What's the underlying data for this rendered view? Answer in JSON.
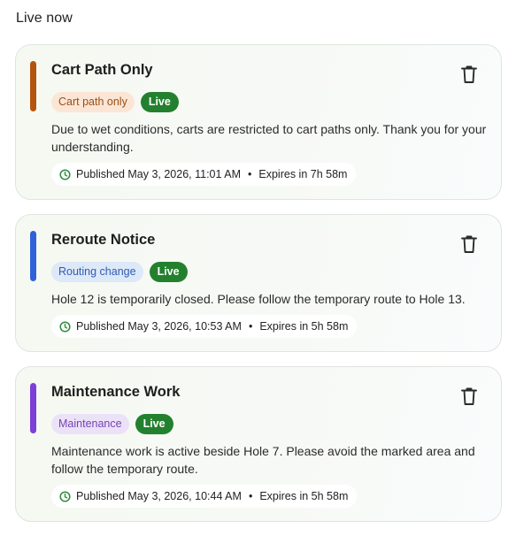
{
  "section": {
    "title": "Live now"
  },
  "colors": {
    "live_badge_bg": "#23802e",
    "clock_icon": "#2e8b3d"
  },
  "notices": [
    {
      "title": "Cart Path Only",
      "accent_color": "#b5540f",
      "category": {
        "label": "Cart path only",
        "bg": "#fbe6d6",
        "fg": "#9b4e15"
      },
      "status": "Live",
      "message": "Due to wet conditions, carts are restricted to cart paths only. Thank you for your understanding.",
      "published": "Published May 3, 2026, 11:01 AM",
      "separator": "•",
      "expires": "Expires in 7h 58m",
      "icons": {
        "delete": "trash-icon",
        "time": "clock-icon"
      }
    },
    {
      "title": "Reroute Notice",
      "accent_color": "#2f62d8",
      "category": {
        "label": "Routing change",
        "bg": "#dde8f9",
        "fg": "#2f5db0"
      },
      "status": "Live",
      "message": "Hole 12 is temporarily closed. Please follow the temporary route to Hole 13.",
      "published": "Published May 3, 2026, 10:53 AM",
      "separator": "•",
      "expires": "Expires in 5h 58m",
      "icons": {
        "delete": "trash-icon",
        "time": "clock-icon"
      }
    },
    {
      "title": "Maintenance Work",
      "accent_color": "#7c3fd9",
      "category": {
        "label": "Maintenance",
        "bg": "#ece2f8",
        "fg": "#7443b3"
      },
      "status": "Live",
      "message": "Maintenance work is active beside Hole 7. Please avoid the marked area and follow the temporary route.",
      "published": "Published May 3, 2026, 10:44 AM",
      "separator": "•",
      "expires": "Expires in 5h 58m",
      "icons": {
        "delete": "trash-icon",
        "time": "clock-icon"
      }
    }
  ]
}
